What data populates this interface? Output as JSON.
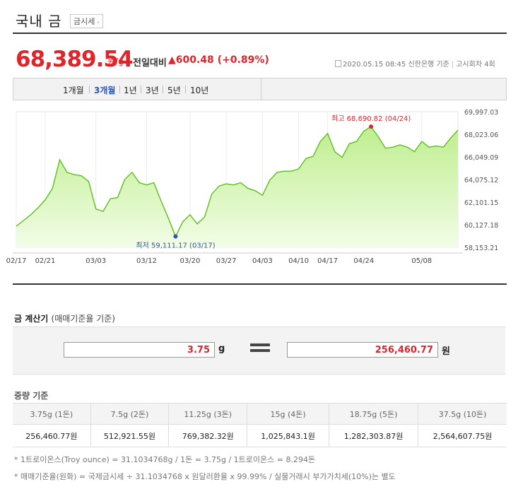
{
  "header": {
    "title": "국내 금",
    "chip_label": "금시세",
    "chip_arrow": "›"
  },
  "price": {
    "value": "68,389.54",
    "unit": "원/g",
    "diff_label": "전일대비",
    "diff_value": "▲600.48 (+0.89%)"
  },
  "meta": {
    "datetime": "2020.05.15 08:45",
    "bank": "신한은행 기준",
    "round": "고시회차 4회"
  },
  "tabs": [
    {
      "label": "1개월",
      "active": false
    },
    {
      "label": "3개월",
      "active": true
    },
    {
      "label": "1년",
      "active": false
    },
    {
      "label": "3년",
      "active": false
    },
    {
      "label": "5년",
      "active": false
    },
    {
      "label": "10년",
      "active": false
    }
  ],
  "chart_data": {
    "type": "area",
    "title": "",
    "xlabel": "",
    "ylabel": "",
    "ylim": [
      58153.21,
      69997.03
    ],
    "y_ticks": [
      "69,997.03",
      "68,023.06",
      "66,049.09",
      "64,075.12",
      "62,101.15",
      "60,127.18",
      "58,153.21"
    ],
    "x_ticks": [
      {
        "label": "02/17",
        "index": 0
      },
      {
        "label": "02/21",
        "index": 4
      },
      {
        "label": "03/03",
        "index": 11
      },
      {
        "label": "03/12",
        "index": 18
      },
      {
        "label": "03/20",
        "index": 24
      },
      {
        "label": "03/27",
        "index": 29
      },
      {
        "label": "04/03",
        "index": 34
      },
      {
        "label": "04/10",
        "index": 39
      },
      {
        "label": "04/17",
        "index": 43
      },
      {
        "label": "04/24",
        "index": 48
      },
      {
        "label": "05/08",
        "index": 56
      }
    ],
    "values": [
      60000,
      60500,
      61000,
      61600,
      62300,
      63300,
      65800,
      64700,
      64500,
      64400,
      63900,
      61500,
      61300,
      62400,
      62500,
      64100,
      64700,
      63800,
      63600,
      63800,
      62200,
      60700,
      59111.17,
      60400,
      61000,
      60200,
      60800,
      62800,
      63500,
      63700,
      63600,
      63800,
      63300,
      63100,
      62700,
      64000,
      64700,
      64800,
      64800,
      65000,
      65900,
      66100,
      67400,
      68100,
      66500,
      66000,
      67200,
      67400,
      68300,
      68690.82,
      67800,
      66800,
      66900,
      67100,
      66900,
      66500,
      67400,
      66900,
      67000,
      66900,
      67700,
      68389.54
    ],
    "high": {
      "label": "최고 68,690.82 (04/24)",
      "index": 49
    },
    "low": {
      "label": "최저 59,111.17 (03/17)",
      "index": 22
    },
    "colors": {
      "line": "#5bbf1c",
      "fill_top": "#bfee8f",
      "fill_bottom": "#f2fde6",
      "high": "#e0242b",
      "low": "#2f56a8"
    }
  },
  "calculator": {
    "title": "금 계산기",
    "subtitle": "(매매기준율 기준)",
    "gram_value": "3.75",
    "gram_unit": "g",
    "won_value": "256,460.77",
    "won_unit": "원"
  },
  "weight": {
    "title": "중량 기준",
    "headers": [
      "3.75g (1돈)",
      "7.5g (2돈)",
      "11.25g (3돈)",
      "15g (4돈)",
      "18.75g (5돈)",
      "37.5g (10돈)"
    ],
    "values": [
      "256,460.77원",
      "512,921.55원",
      "769,382.32원",
      "1,025,843.1원",
      "1,282,303.87원",
      "2,564,607.75원"
    ]
  },
  "footnotes": [
    "* 1트로이온스(Troy ounce) = 31.1034768g / 1돈 = 3.75g / 1트로이온스 = 8.294돈",
    "* 매매기준율(원화) = 국제금시세 ÷ 31.1034768 x 원달러환율 x 99.99% / 실물거래시 부가가치세(10%)는 별도"
  ]
}
